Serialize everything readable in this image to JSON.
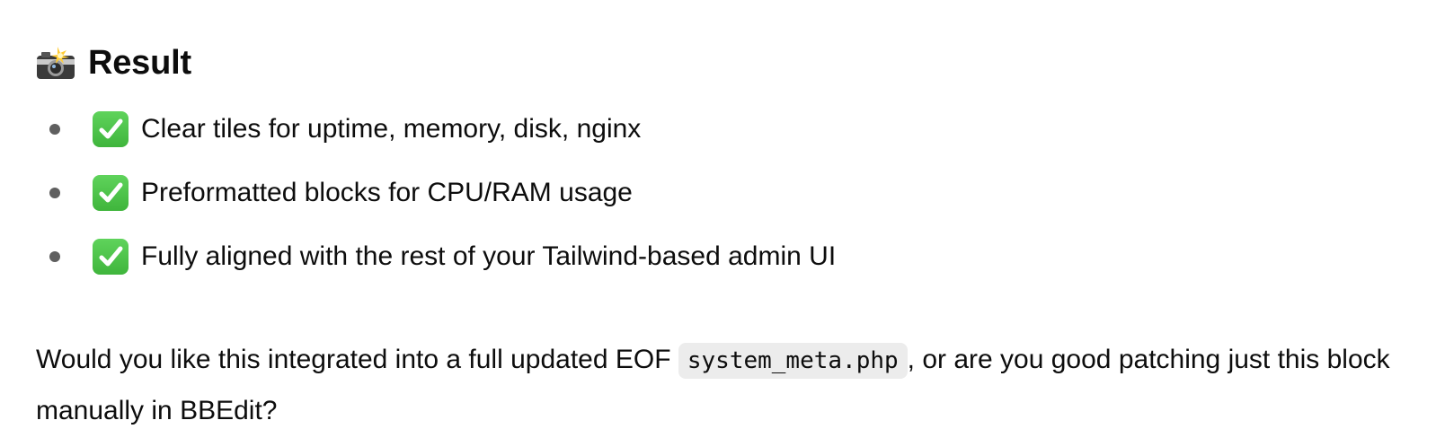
{
  "heading": {
    "icon": "camera-flash-icon",
    "title": "Result"
  },
  "bullets": [
    {
      "icon": "check-mark-button-icon",
      "text": "Clear tiles for uptime, memory, disk, nginx"
    },
    {
      "icon": "check-mark-button-icon",
      "text": "Preformatted blocks for CPU/RAM usage"
    },
    {
      "icon": "check-mark-button-icon",
      "text": "Fully aligned with the rest of your Tailwind-based admin UI"
    }
  ],
  "question": {
    "before": "Would you like this integrated into a full updated EOF ",
    "code": "system_meta.php",
    "after": ", or are you good patching just this block manually in BBEdit?"
  },
  "colors": {
    "text": "#0d0d0d",
    "bullet": "#5f5f5f",
    "check_green": "#4cc34a",
    "code_bg": "#ececec"
  }
}
